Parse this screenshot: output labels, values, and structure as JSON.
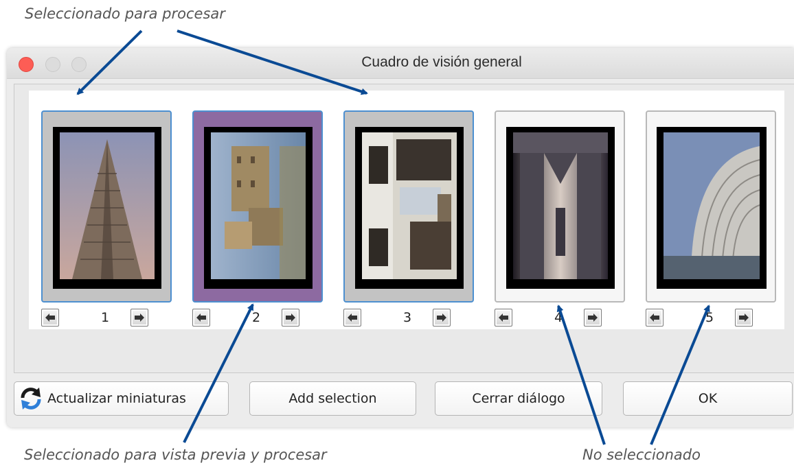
{
  "annotations": {
    "selected_for_processing": "Seleccionado para procesar",
    "selected_for_preview": "Seleccionado para vista previa y procesar",
    "not_selected": "No seleccionado"
  },
  "window": {
    "title": "Cuadro de visión general"
  },
  "frames": [
    {
      "number": "1",
      "state": "selected"
    },
    {
      "number": "2",
      "state": "preview"
    },
    {
      "number": "3",
      "state": "selected"
    },
    {
      "number": "4",
      "state": "not-selected"
    },
    {
      "number": "5",
      "state": "not-selected"
    }
  ],
  "buttons": {
    "refresh": "Actualizar miniaturas",
    "add_selection": "Add selection",
    "close": "Cerrar diálogo",
    "ok": "OK"
  },
  "colors": {
    "selected_fill": "#c3c3c3",
    "preview_fill": "#8d6aa1",
    "selection_border": "#4c8fd0",
    "arrow": "#0a4a94"
  }
}
